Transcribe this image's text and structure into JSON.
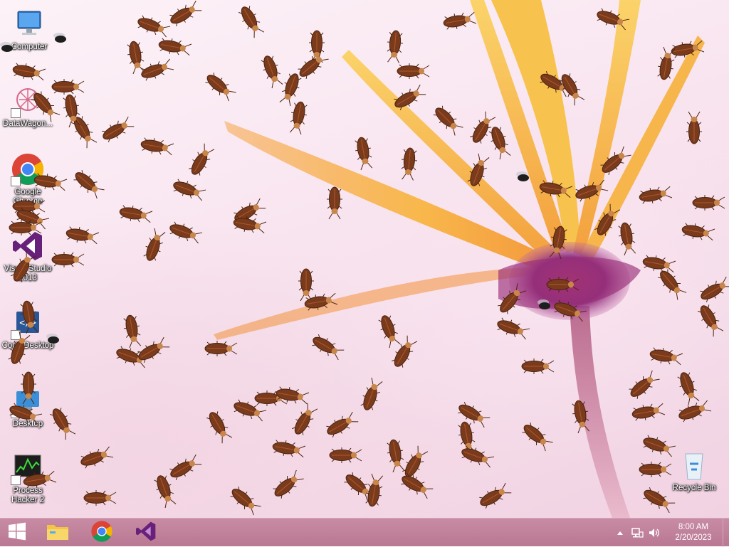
{
  "desktop": {
    "icons": [
      {
        "id": "computer",
        "label": "Computer"
      },
      {
        "id": "datawagon",
        "label": "DataWagon..."
      },
      {
        "id": "google-chrome",
        "label": "Google Chrome"
      },
      {
        "id": "visual-studio",
        "label": "Visual Studio 2013"
      },
      {
        "id": "code-desktop",
        "label": "Code Desktop"
      },
      {
        "id": "desktop-shortcut",
        "label": "Desktop"
      },
      {
        "id": "process-hacker",
        "label": "Process Hacker 2"
      },
      {
        "id": "recycle-bin",
        "label": "Recycle Bin"
      }
    ]
  },
  "taskbar": {
    "start_icon": "windows-logo-icon",
    "pinned": [
      {
        "id": "file-explorer",
        "icon": "folder-icon"
      },
      {
        "id": "chrome",
        "icon": "chrome-icon"
      },
      {
        "id": "visual-studio",
        "icon": "visual-studio-icon"
      }
    ],
    "tray": {
      "overflow_icon": "chevron-up-icon",
      "network_icon": "network-icon",
      "volume_icon": "speaker-icon",
      "time": "8:00 AM",
      "date": "2/20/2023"
    }
  },
  "colors": {
    "taskbar": "#c2849e",
    "petal": "#f6b24a",
    "flower_center": "#8e2f7d",
    "roach": "#7a3a1c"
  }
}
